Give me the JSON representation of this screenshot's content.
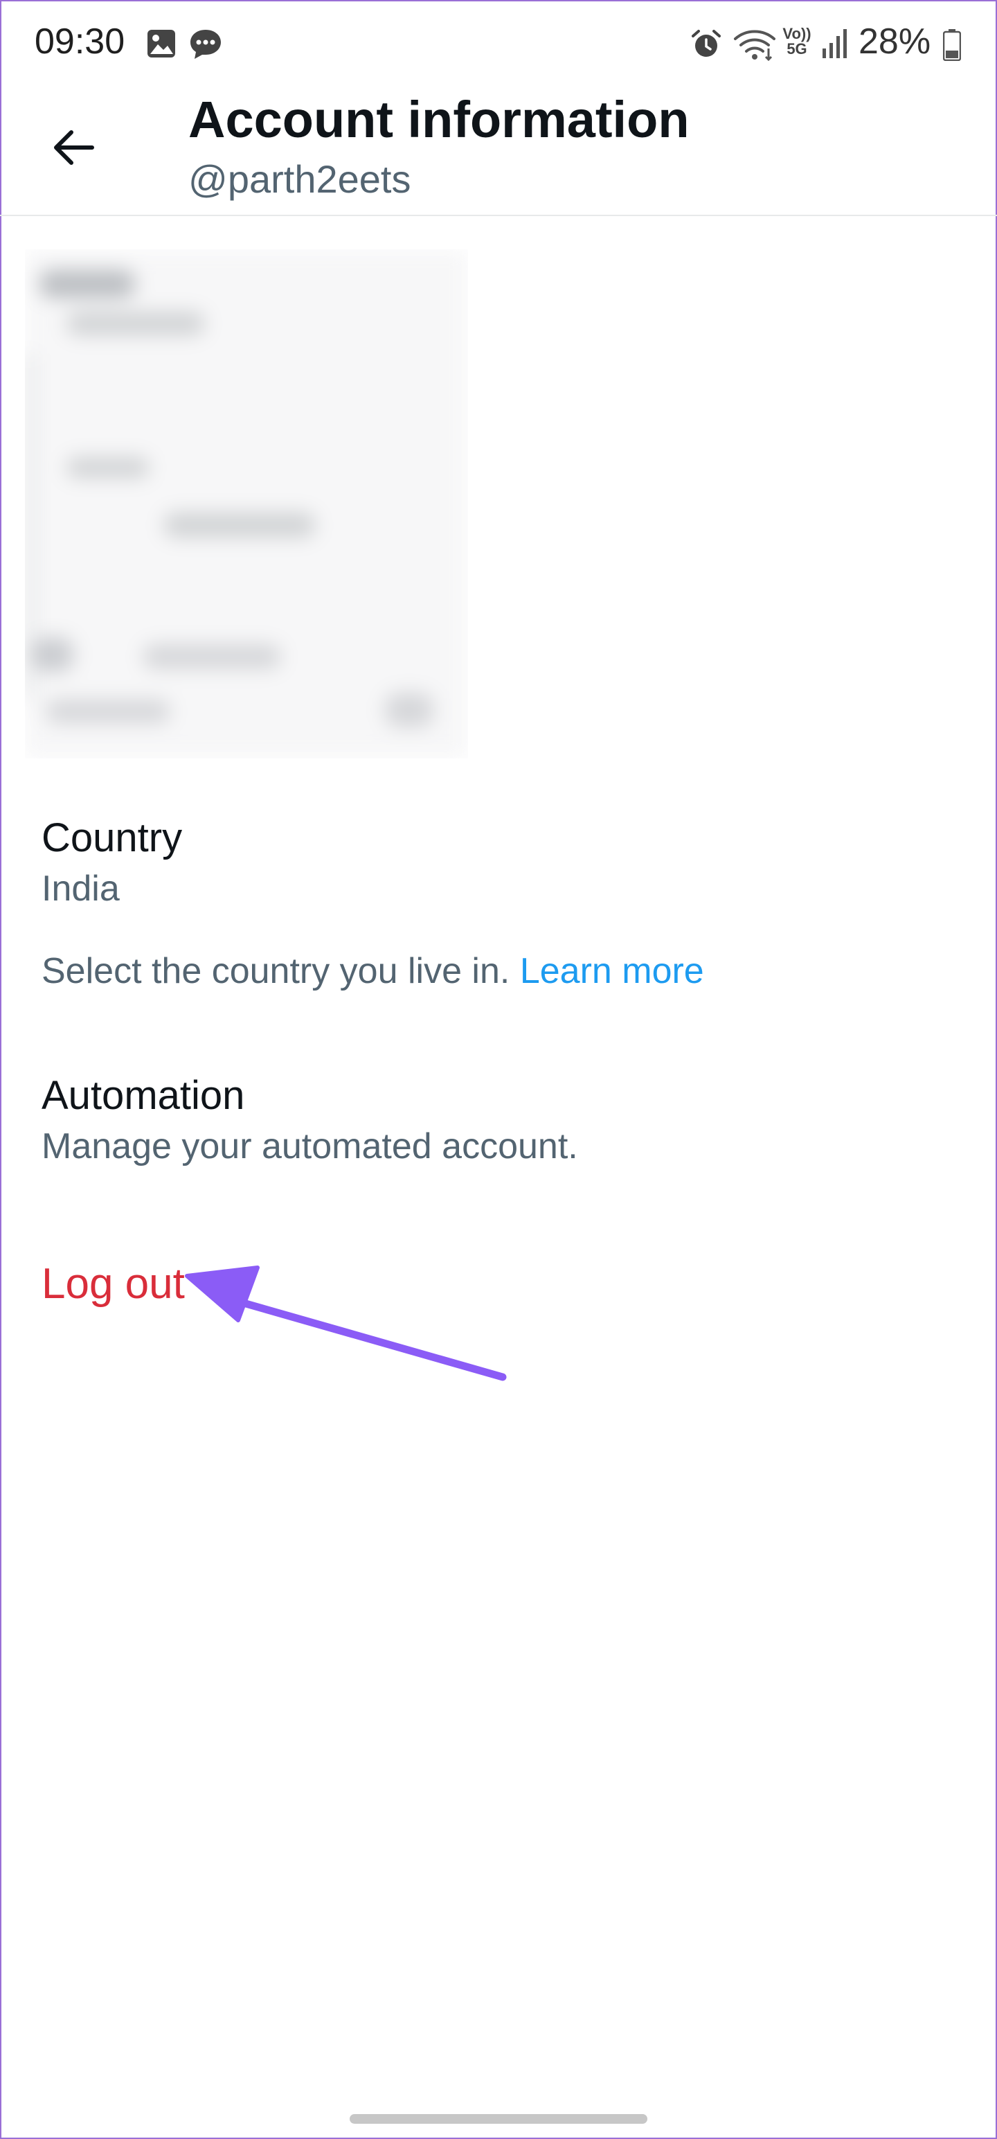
{
  "status_bar": {
    "time": "09:30",
    "left_icons": [
      "gallery-icon",
      "chat-icon"
    ],
    "right_icons": [
      "alarm-icon",
      "wifi-icon",
      "volte-5g-icon",
      "signal-icon",
      "battery-icon"
    ],
    "volte_text": "Vo)) 5G",
    "battery_percent": "28%"
  },
  "header": {
    "title": "Account information",
    "handle": "@parth2eets",
    "back_icon": "back-arrow-icon"
  },
  "redacted_section": {
    "state": "blurred"
  },
  "country": {
    "title": "Country",
    "value": "India",
    "help_text": "Select the country you live in.",
    "learn_more": "Learn more"
  },
  "automation": {
    "title": "Automation",
    "description": "Manage your automated account."
  },
  "logout": {
    "label": "Log out"
  },
  "colors": {
    "link": "#1d9bf0",
    "danger": "#d92d3a",
    "annotation_arrow": "#8b5cf6",
    "secondary_text": "#536471"
  }
}
